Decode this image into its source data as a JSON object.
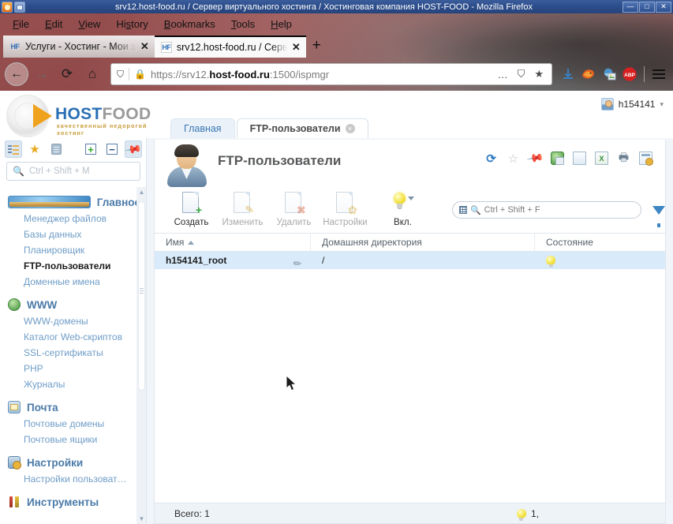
{
  "window": {
    "title": "srv12.host-food.ru / Сервер виртуального хостинга / Хостинговая компания HOST-FOOD - Mozilla Firefox",
    "minimize": "—",
    "maximize": "□",
    "close": "✕"
  },
  "browser": {
    "menu": [
      "File",
      "Edit",
      "View",
      "History",
      "Bookmarks",
      "Tools",
      "Help"
    ],
    "tabs": [
      {
        "label": "Услуги - Хостинг - Мои з",
        "favicon": "HF",
        "active": false,
        "close": "✕"
      },
      {
        "label": "srv12.host-food.ru / Серв",
        "favicon": "HF",
        "active": true,
        "close": "✕"
      }
    ],
    "new_tab": "+",
    "nav": {
      "back": "←",
      "forward": "→",
      "reload": "⟳",
      "home": "⌂"
    },
    "url": {
      "prefix": "https://srv12.",
      "domain": "host-food.ru",
      "suffix": ":1500/ispmgr",
      "full": "https://srv12.host-food.ru:1500/ispmgr",
      "shield_icon": "shield-icon",
      "lock_icon": "lock-icon",
      "page_actions": "…",
      "reader_icon": "reader-icon",
      "bookmark_icon": "★"
    },
    "toolbar_icons": [
      "downloads-icon",
      "firefox-account-icon",
      "extension-icon",
      "adblock-plus-icon",
      "menu-hamburger-icon"
    ],
    "adblock_label": "ABP"
  },
  "ispmanager": {
    "logo": {
      "host": "HOST",
      "food": "FOOD",
      "tagline": "качественный недорогой хостинг"
    },
    "user": {
      "name": "h154141",
      "caret": "▾"
    },
    "tabs": [
      {
        "label": "Главная",
        "active": false
      },
      {
        "label": "FTP-пользователи",
        "active": true,
        "close": "×"
      }
    ],
    "sidebar": {
      "tools": [
        "tree-view-icon",
        "favorites-star-icon",
        "clipboard-icon",
        "expand-all-icon",
        "collapse-all-icon",
        "pin-icon"
      ],
      "search_placeholder": "Ctrl + Shift + M",
      "groups": [
        {
          "title": "Главное",
          "icon": "main-icon",
          "items": [
            {
              "label": "Менеджер файлов",
              "active": false
            },
            {
              "label": "Базы данных",
              "active": false
            },
            {
              "label": "Планировщик",
              "active": false
            },
            {
              "label": "FTP-пользователи",
              "active": true
            },
            {
              "label": "Доменные имена",
              "active": false
            }
          ]
        },
        {
          "title": "WWW",
          "icon": "www-icon",
          "items": [
            {
              "label": "WWW-домены",
              "active": false
            },
            {
              "label": "Каталог Web-скриптов",
              "active": false
            },
            {
              "label": "SSL-сертификаты",
              "active": false
            },
            {
              "label": "PHP",
              "active": false
            },
            {
              "label": "Журналы",
              "active": false
            }
          ]
        },
        {
          "title": "Почта",
          "icon": "mail-icon",
          "items": [
            {
              "label": "Почтовые домены",
              "active": false
            },
            {
              "label": "Почтовые ящики",
              "active": false
            }
          ]
        },
        {
          "title": "Настройки",
          "icon": "settings-icon",
          "items": [
            {
              "label": "Настройки пользоват…",
              "active": false
            }
          ]
        },
        {
          "title": "Инструменты",
          "icon": "tools-icon",
          "items": []
        }
      ]
    },
    "panel": {
      "title": "FTP-пользователи",
      "header_icons": [
        "refresh-icon",
        "add-to-favorites-icon",
        "pin-icon",
        "open-in-browser-icon",
        "export-doc-icon",
        "export-excel-icon",
        "print-icon",
        "table-settings-icon"
      ],
      "toolbar": [
        {
          "label": "Создать",
          "icon": "create-icon",
          "disabled": false
        },
        {
          "label": "Изменить",
          "icon": "edit-icon",
          "disabled": true
        },
        {
          "label": "Удалить",
          "icon": "delete-icon",
          "disabled": true
        },
        {
          "label": "Настройки",
          "icon": "settings-icon",
          "disabled": true
        }
      ],
      "bulb_button": {
        "label": "Вкл.",
        "icon": "lightbulb-icon",
        "caret": "▾"
      },
      "search_placeholder": "Ctrl + Shift + F",
      "filter_icon": "filter-funnel-icon",
      "table": {
        "columns": [
          {
            "label": "Имя",
            "sorted": "asc"
          },
          {
            "label": "Домашняя директория",
            "sorted": ""
          },
          {
            "label": "Состояние",
            "sorted": ""
          }
        ],
        "rows": [
          {
            "name": "h154141_root",
            "home": "/",
            "state": "lightbulb-on-icon",
            "selected": true,
            "edit_icon": "pencil-icon"
          }
        ]
      },
      "footer": {
        "total": "Всего: 1",
        "state_count": "1,",
        "state_icon": "lightbulb-on-icon"
      }
    }
  }
}
